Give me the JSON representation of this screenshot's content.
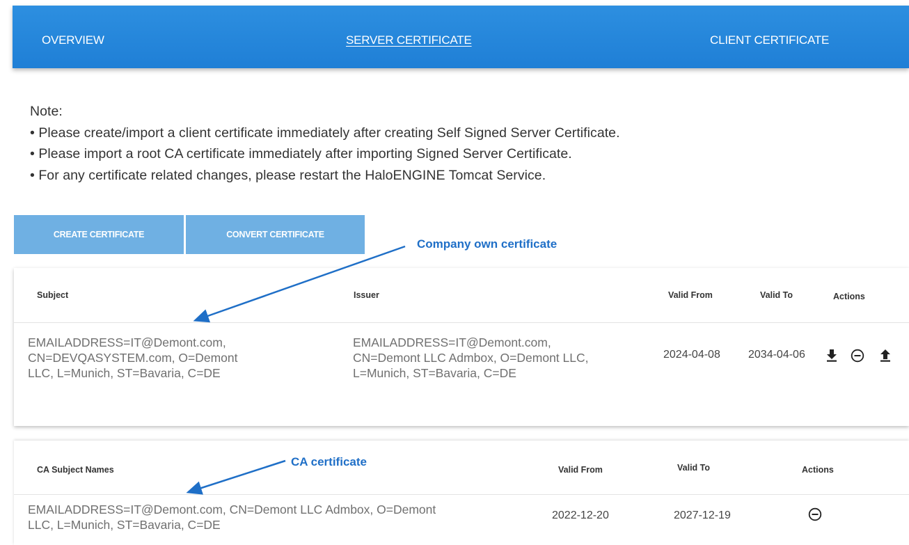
{
  "tabs": {
    "overview": "OVERVIEW",
    "server_certificate": "SERVER CERTIFICATE",
    "client_certificate": "CLIENT CERTIFICATE"
  },
  "note": {
    "title": "Note:",
    "items": [
      "• Please create/import a client certificate immediately after creating Self Signed Server Certificate.",
      "• Please import a root CA certificate immediately after importing Signed Server Certificate.",
      "• For any certificate related changes, please restart the HaloENGINE Tomcat Service."
    ]
  },
  "buttons": {
    "create": "CREATE CERTIFICATE",
    "convert": "CONVERT CERTIFICATE"
  },
  "annotations": {
    "company": "Company own certificate",
    "ca": "CA certificate"
  },
  "server_table": {
    "headers": {
      "subject": "Subject",
      "issuer": "Issuer",
      "valid_from": "Valid From",
      "valid_to": "Valid To",
      "actions": "Actions"
    },
    "rows": [
      {
        "subject_lines": [
          "EMAILADDRESS=IT@Demont.com,",
          "CN=DEVQASYSTEM.com, O=Demont",
          "LLC, L=Munich, ST=Bavaria, C=DE"
        ],
        "issuer_lines": [
          "EMAILADDRESS=IT@Demont.com,",
          "CN=Demont LLC Admbox, O=Demont LLC,",
          "L=Munich, ST=Bavaria, C=DE"
        ],
        "valid_from": "2024-04-08",
        "valid_to": "2034-04-06",
        "action_icons": [
          "download-icon",
          "remove-circle-icon",
          "upload-icon"
        ]
      }
    ]
  },
  "ca_table": {
    "headers": {
      "subject": "CA Subject Names",
      "valid_from": "Valid From",
      "valid_to": "Valid To",
      "actions": "Actions"
    },
    "rows": [
      {
        "subject_lines": [
          "EMAILADDRESS=IT@Demont.com, CN=Demont LLC Admbox, O=Demont",
          "LLC, L=Munich, ST=Bavaria, C=DE"
        ],
        "valid_from": "2022-12-20",
        "valid_to": "2027-12-19",
        "action_icons": [
          "remove-circle-icon"
        ]
      }
    ]
  },
  "colors": {
    "nav": "#1f7fd6",
    "button": "#6fb0e3",
    "annotation": "#1f6fc7"
  }
}
